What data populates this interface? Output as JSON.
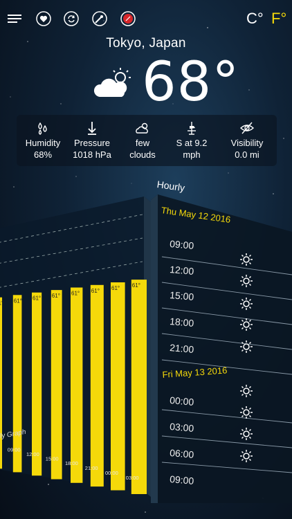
{
  "units": {
    "c_label": "C°",
    "f_label": "F°"
  },
  "location": {
    "city": "Tokyo, Japan"
  },
  "current": {
    "temp": "68°"
  },
  "info": [
    {
      "label": "Humidity",
      "value": "68%",
      "icon": "humidity-icon"
    },
    {
      "label": "Pressure",
      "value": "1018 hPa",
      "icon": "pressure-icon"
    },
    {
      "label": "few",
      "value": "clouds",
      "icon": "few-clouds-icon"
    },
    {
      "label": "S at 9.2",
      "value": "mph",
      "icon": "wind-icon"
    },
    {
      "label": "Visibility",
      "value": "0.0 mi",
      "icon": "visibility-icon"
    }
  ],
  "graph": {
    "label": "rly Graph"
  },
  "chart_data": {
    "type": "bar",
    "categories": [
      "09:00",
      "12:00",
      "15:00",
      "18:00",
      "21:00",
      "00:00",
      "03:00"
    ],
    "values": [
      61,
      61,
      61,
      61,
      61,
      61,
      61
    ],
    "value_labels": [
      "61°",
      "61°",
      "61°",
      "61°",
      "61°",
      "61°",
      "61°",
      "61°"
    ],
    "color": "#f5d90a"
  },
  "hourly": {
    "title": "Hourly",
    "days": [
      {
        "date": "Thu May 12 2016",
        "times": [
          "09:00",
          "12:00",
          "15:00",
          "18:00",
          "21:00"
        ]
      },
      {
        "date": "Fri May 13 2016",
        "times": [
          "00:00",
          "03:00",
          "06:00",
          "09:00"
        ]
      }
    ]
  },
  "colors": {
    "accent": "#f5d90a"
  }
}
